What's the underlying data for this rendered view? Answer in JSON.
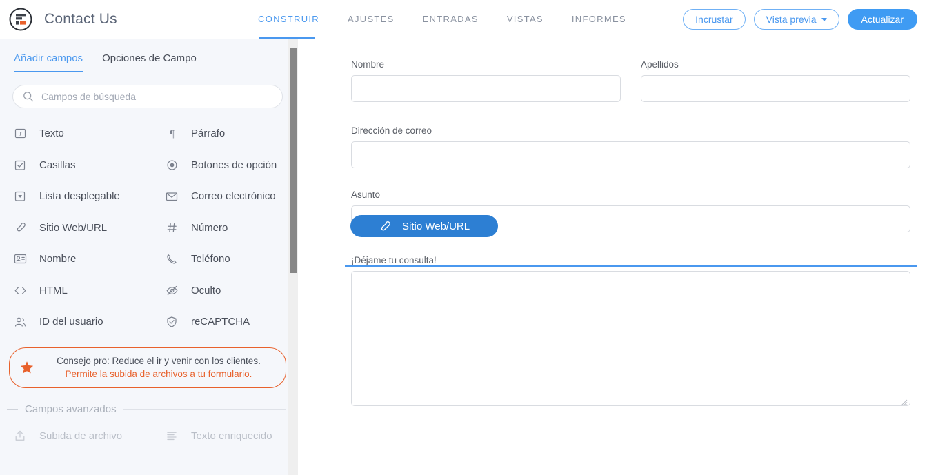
{
  "header": {
    "logo_icon": "formidable-forms-logo",
    "title": "Contact Us",
    "nav": [
      {
        "label": "CONSTRUIR",
        "active": true
      },
      {
        "label": "AJUSTES",
        "active": false
      },
      {
        "label": "ENTRADAS",
        "active": false
      },
      {
        "label": "VISTAS",
        "active": false
      },
      {
        "label": "INFORMES",
        "active": false
      }
    ],
    "actions": {
      "embed_label": "Incrustar",
      "preview_label": "Vista previa",
      "preview_caret_icon": "chevron-down-icon",
      "update_label": "Actualizar"
    }
  },
  "sidebar": {
    "tabs": [
      {
        "label": "Añadir campos",
        "active": true
      },
      {
        "label": "Opciones de Campo",
        "active": false
      }
    ],
    "search": {
      "icon": "search-icon",
      "placeholder": "Campos de búsqueda",
      "value": ""
    },
    "fields": [
      {
        "label": "Texto",
        "icon": "text-field-icon",
        "dim": false
      },
      {
        "label": "Párrafo",
        "icon": "paragraph-icon",
        "dim": false
      },
      {
        "label": "Casillas",
        "icon": "checkbox-icon",
        "dim": false
      },
      {
        "label": "Botones de opción",
        "icon": "radio-button-icon",
        "dim": false
      },
      {
        "label": "Lista desplegable",
        "icon": "dropdown-icon",
        "dim": false
      },
      {
        "label": "Correo electrónico",
        "icon": "email-icon",
        "dim": false
      },
      {
        "label": "Sitio Web/URL",
        "icon": "link-icon",
        "dim": false
      },
      {
        "label": "Número",
        "icon": "hash-icon",
        "dim": false
      },
      {
        "label": "Nombre",
        "icon": "id-card-icon",
        "dim": false
      },
      {
        "label": "Teléfono",
        "icon": "phone-icon",
        "dim": false
      },
      {
        "label": "HTML",
        "icon": "code-icon",
        "dim": false
      },
      {
        "label": "Oculto",
        "icon": "eye-off-icon",
        "dim": false
      },
      {
        "label": "ID del usuario",
        "icon": "users-icon",
        "dim": false
      },
      {
        "label": "reCAPTCHA",
        "icon": "shield-check-icon",
        "dim": false
      }
    ],
    "protip": {
      "star_icon": "star-icon",
      "text": "Consejo pro: Reduce el ir y venir con los clientes. ",
      "link_text": "Permite la subida de archivos a tu formulario."
    },
    "advanced": {
      "title": "Campos avanzados",
      "fields": [
        {
          "label": "Subida de archivo",
          "icon": "upload-icon",
          "dim": true
        },
        {
          "label": "Texto enriquecido",
          "icon": "rich-text-icon",
          "dim": true
        }
      ]
    },
    "scrollbar": {
      "name": "sidebar-scrollbar"
    }
  },
  "form": {
    "row1": [
      {
        "label": "Nombre",
        "value": "",
        "placeholder": ""
      },
      {
        "label": "Apellidos",
        "value": "",
        "placeholder": ""
      }
    ],
    "email": {
      "label": "Dirección de correo",
      "value": "",
      "placeholder": ""
    },
    "subject": {
      "label": "Asunto",
      "value": "",
      "placeholder": ""
    },
    "message": {
      "label": "¡Déjame tu consulta!",
      "value": "",
      "placeholder": ""
    },
    "drag": {
      "label": "Sitio Web/URL",
      "icon": "link-icon",
      "drop_indicator": "drop-indicator-line"
    }
  },
  "colors": {
    "accent_blue": "#4a98ef",
    "drag_blue": "#2d7fd3",
    "orange": "#e8612c",
    "sidebar_bg": "#f5f7fb",
    "border": "#d9dce1"
  }
}
